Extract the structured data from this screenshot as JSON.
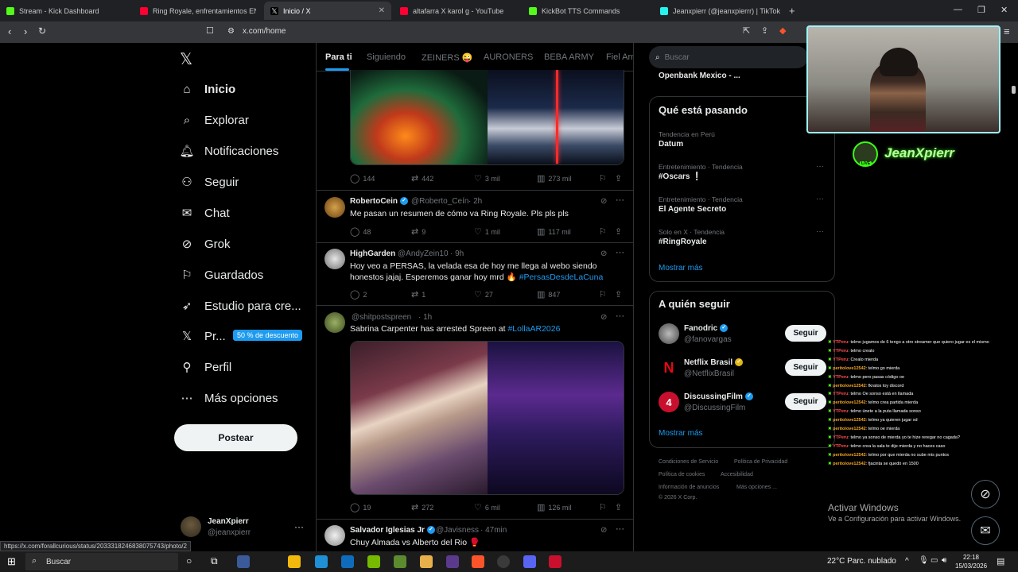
{
  "browser": {
    "tabs": [
      {
        "label": "Stream - Kick Dashboard",
        "color": "#53fc18"
      },
      {
        "label": "Ring Royale, enfrentamientos EN VIVO",
        "color": "#ff0033"
      },
      {
        "label": "Inicio / X",
        "color": "#ffffff"
      },
      {
        "label": "altafarra X karol g - YouTube",
        "color": "#ff0033"
      },
      {
        "label": "KickBot TTS Commands",
        "color": "#53fc18"
      },
      {
        "label": "Jeanxpierr (@jeanxpierrr) | TikTok",
        "color": "#25f4ee"
      }
    ],
    "url": "x.com/home",
    "status_url": "https://x.com/forallcurious/status/2033318246838075743/photo/2"
  },
  "sidebar": {
    "items": [
      {
        "label": "Inicio",
        "icon": "home-icon"
      },
      {
        "label": "Explorar",
        "icon": "search-icon"
      },
      {
        "label": "Notificaciones",
        "icon": "bell-icon"
      },
      {
        "label": "Seguir",
        "icon": "add-person-icon"
      },
      {
        "label": "Chat",
        "icon": "mail-icon"
      },
      {
        "label": "Grok",
        "icon": "grok-icon"
      },
      {
        "label": "Guardados",
        "icon": "bookmark-icon"
      },
      {
        "label": "Estudio para cre...",
        "icon": "rocket-icon"
      },
      {
        "label": "Pr...",
        "icon": "x-logo-icon"
      },
      {
        "label": "Perfil",
        "icon": "person-icon"
      },
      {
        "label": "Más opciones",
        "icon": "more-circle-icon"
      }
    ],
    "discount_badge": "50 % de descuento",
    "post_button": "Postear",
    "profile": {
      "name": "JeanXpierr",
      "handle": "@jeanxpierr"
    }
  },
  "feed": {
    "tabs": [
      "Para ti",
      "Siguiendo",
      "ZEINERS 😜",
      "AURONERS",
      "BEBA ARMY",
      "Fiel Arm"
    ],
    "posts": [
      {
        "replies": "144",
        "reposts": "442",
        "likes": "3 mil",
        "views": "273 mil"
      },
      {
        "name": "RobertoCein",
        "handle": "@Roberto_Ceín",
        "time": "· 2h",
        "text": "Me pasan un resumen de cómo va Ring Royale. Pls pls pls",
        "replies": "48",
        "reposts": "9",
        "likes": "1 mil",
        "views": "117 mil"
      },
      {
        "name": "HighGarden",
        "handle": "@AndyZein10",
        "time": "· 9h",
        "text": "Hoy veo a PERSAS, la velada esa de hoy me llega al webo siendo honestos jajaj. Esperemos ganar hoy mrd 🔥",
        "link": "#PersasDesdeLaCuna",
        "replies": "2",
        "reposts": "1",
        "likes": "27",
        "views": "847"
      },
      {
        "handle": "@shitpostspreen",
        "time": "· 1h",
        "text": "Sabrina Carpenter has arrested Spreen at",
        "link": "#LollaAR2026",
        "replies": "19",
        "reposts": "272",
        "likes": "6 mil",
        "views": "126 mil"
      },
      {
        "name": "Salvador Iglesias Jr",
        "handle": "@Javisness",
        "time": "· 47min",
        "text": "Chuy Almada vs Alberto del Rio 🥊"
      }
    ]
  },
  "right": {
    "search_placeholder": "Buscar",
    "top_snippet": "Openbank Mexico - ...",
    "trending_title": "Qué está pasando",
    "trends": [
      {
        "meta": "Tendencia en Perú",
        "name": "Datum"
      },
      {
        "meta": "Entretenimiento · Tendencia",
        "name": "#Oscars ❕"
      },
      {
        "meta": "Entretenimiento · Tendencia",
        "name": "El Agente Secreto"
      },
      {
        "meta": "Solo en X · Tendencia",
        "name": "#RingRoyale"
      }
    ],
    "show_more": "Mostrar más",
    "follow_title": "A quién seguir",
    "follow": [
      {
        "name": "Fanodric",
        "handle": "@fanovargas",
        "button": "Seguir"
      },
      {
        "name": "Netflix Brasil",
        "handle": "@NetflixBrasil",
        "button": "Seguir"
      },
      {
        "name": "DiscussingFilm",
        "handle": "@DiscussingFilm",
        "button": "Seguir"
      }
    ],
    "footer": [
      "Condiciones de Servicio",
      "Política de Privacidad",
      "Política de cookies",
      "Accesibilidad",
      "Información de anuncios",
      "Más opciones ...",
      "© 2026 X Corp."
    ]
  },
  "overlay": {
    "streamer": "JeanXpierr",
    "live": "LIVE",
    "chat": [
      {
        "user": "YTPeru",
        "msg": ": telmo jugamos de 6 tengo a otro streamer que quiero jugar es el mismo",
        "color": "#ff4d4d"
      },
      {
        "user": "YTPeru",
        "msg": ": telmo crealo",
        "color": "#ff4d4d"
      },
      {
        "user": "YTPeru",
        "msg": ": Crealo mierda",
        "color": "#ff4d4d"
      },
      {
        "user": "peritolove12542",
        "msg": ": telmo go mierda",
        "color": "#f5a623"
      },
      {
        "user": "YTPeru",
        "msg": ": telmo pero pasas código oe",
        "color": "#ff4d4d"
      },
      {
        "user": "peritolove12542",
        "msg": ": fkratos toy discord",
        "color": "#f5a623"
      },
      {
        "user": "YTPeru",
        "msg": ": telmo Oe sonso está en llamada",
        "color": "#ff4d4d"
      },
      {
        "user": "peritolove12542",
        "msg": ": telmo crea partida mierda",
        "color": "#f5a623"
      },
      {
        "user": "YTPeru",
        "msg": ": telmo únete a la puta llamada sonso",
        "color": "#ff4d4d"
      },
      {
        "user": "peritolove12542",
        "msg": ": telmo ya quieren jugar xd",
        "color": "#f5a623"
      },
      {
        "user": "peritolove12542",
        "msg": ": telmo oe mierda",
        "color": "#f5a623"
      },
      {
        "user": "YTPeru",
        "msg": ": telmo ya sonso de mierda yo te hize reregar no cagada?",
        "color": "#ff4d4d"
      },
      {
        "user": "YTPeru",
        "msg": ": telmo crea la sala te dije mierda y no haces caso",
        "color": "#ff4d4d"
      },
      {
        "user": "peritolove12542",
        "msg": ": telmo por que mierda no sube mis puntos",
        "color": "#f5a623"
      },
      {
        "user": "peritolove12542",
        "msg": ": fjacinta se quedó en 1500",
        "color": "#f5a623"
      }
    ],
    "activate_title": "Activar Windows",
    "activate_sub": "Ve a Configuración para activar Windows."
  },
  "taskbar": {
    "search": "Buscar",
    "weather": "22°C  Parc. nublado",
    "time": "22:18",
    "date": "15/03/2026"
  },
  "colors": {
    "accent": "#1d9bf0",
    "bg": "#000000",
    "border": "#2f3336"
  }
}
